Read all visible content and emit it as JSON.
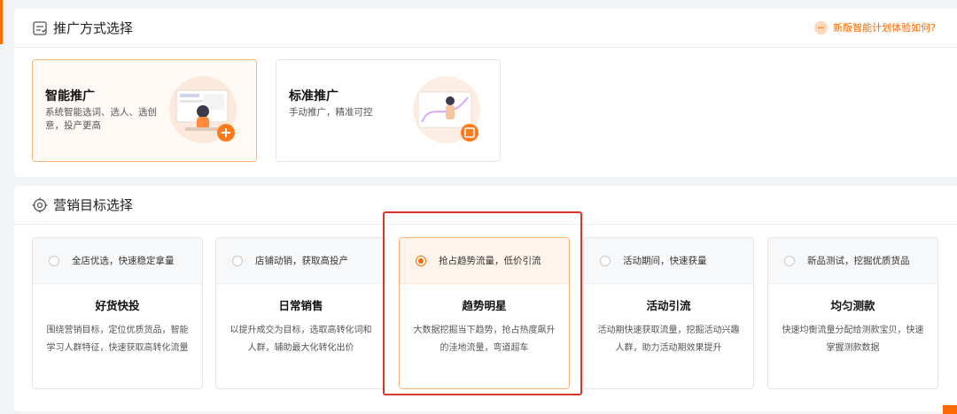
{
  "section_promo": {
    "title": "推广方式选择",
    "feedback_link": "新版智能计划体验如何?",
    "cards": [
      {
        "title": "智能推广",
        "desc": "系统智能选词、选人、选创意，投产更高",
        "selected": true
      },
      {
        "title": "标准推广",
        "desc": "手动推广，精准可控",
        "selected": false
      }
    ]
  },
  "section_goal": {
    "title": "营销目标选择",
    "cards": [
      {
        "tag": "全店优选，快速稳定拿量",
        "name": "好货快投",
        "desc": "围绕营销目标，定位优质货品，智能学习人群特征，快速获取高转化流量",
        "selected": false
      },
      {
        "tag": "店铺动销，获取高投产",
        "name": "日常销售",
        "desc": "以提升成交为目标，选取高转化词和人群，辅助最大化转化出价",
        "selected": false
      },
      {
        "tag": "抢占趋势流量，低价引流",
        "name": "趋势明星",
        "desc": "大数据挖掘当下趋势，抢占热度飙升的洼地流量，弯道超车",
        "selected": true
      },
      {
        "tag": "活动期间，快速获量",
        "name": "活动引流",
        "desc": "活动期快速获取流量，挖掘活动兴趣人群，助力活动期效果提升",
        "selected": false
      },
      {
        "tag": "新品测试，挖掘优质货品",
        "name": "均匀测款",
        "desc": "快速均衡流量分配给测款宝贝，快速掌握测款数据",
        "selected": false
      }
    ]
  },
  "colors": {
    "accent": "#ff6a00",
    "highlight": "#d9362b"
  }
}
